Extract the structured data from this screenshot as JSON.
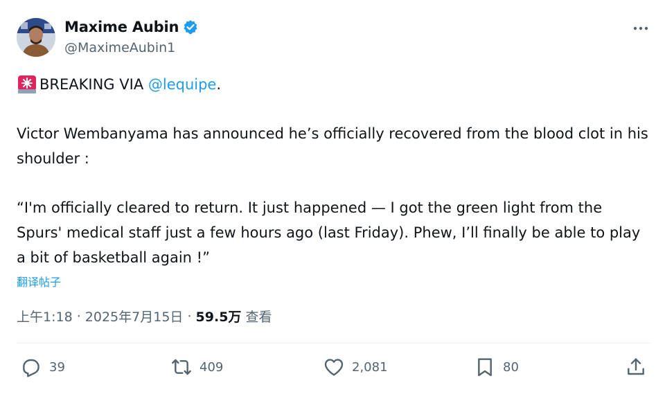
{
  "author": {
    "display_name": "Maxime Aubin",
    "handle": "@MaximeAubin1"
  },
  "tweet": {
    "line1_prefix": "BREAKING VIA ",
    "line1_mention": "@lequipe",
    "line1_suffix": ".",
    "paragraph2": "Victor Wembanyama has announced he’s officially recovered from the blood clot in his shoulder :",
    "paragraph3": "“I'm officially cleared to return. It just happened — I got the green light from the Spurs' medical staff just a few hours ago (last Friday). Phew, I’ll finally be able to play a bit of basketball again !”",
    "translate_label": "翻译帖子"
  },
  "meta": {
    "time": "上午1:18",
    "separator": " · ",
    "date": "2025年7月15日",
    "views_count": "59.5万",
    "views_label": "查看"
  },
  "actions": {
    "reply_count": "39",
    "retweet_count": "409",
    "like_count": "2,081",
    "bookmark_count": "80"
  },
  "colors": {
    "accent": "#1d9bf0",
    "secondary_text": "#536471",
    "siren": "#e0245e"
  },
  "icons": [
    "verified-icon",
    "more-icon",
    "siren-icon",
    "reply-icon",
    "retweet-icon",
    "like-icon",
    "bookmark-icon",
    "share-icon"
  ]
}
